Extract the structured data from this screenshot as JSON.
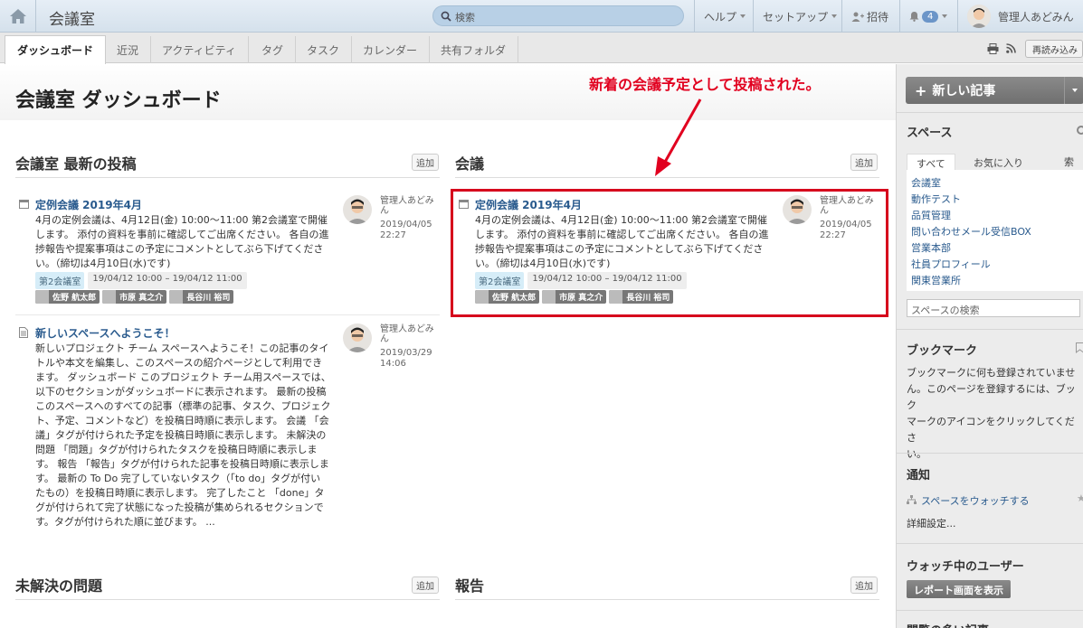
{
  "topbar": {
    "title": "会議室",
    "search_placeholder": "検索",
    "help": "ヘルプ",
    "setup": "セットアップ",
    "invite": "招待",
    "notifications_count": "4",
    "user_name": "管理人あどみん"
  },
  "tabs": [
    "ダッシュボード",
    "近況",
    "アクティビティ",
    "タグ",
    "タスク",
    "カレンダー",
    "共有フォルダ"
  ],
  "reload_label": "再読み込み",
  "page": {
    "title": "会議室 ダッシュボード",
    "annotation": "新着の会議予定として投稿された。"
  },
  "sections": {
    "latest": "会議室 最新の投稿",
    "meetings": "会議",
    "issues": "未解決の問題",
    "reports": "報告",
    "add": "追加"
  },
  "posts": {
    "meeting_left": {
      "title": "定例会議 2019年4月",
      "body": [
        "4月の定例会議は、4月12日(金) 10:00〜11:00 第2会議室で開催",
        "します。 添付の資料を事前に確認してご出席ください。 各自の進",
        "捗報告や提案事項はこの予定にコメントとしてぶら下げてくださ",
        "い。（締切は4月10日(水)です)"
      ],
      "author": [
        "管理人あどみ",
        "ん"
      ],
      "date": "2019/04/05",
      "time": "22:27",
      "room": "第2会議室",
      "range": "19/04/12 10:00 – 19/04/12 11:00",
      "attendees": [
        "佐野 航太郎",
        "市原 真之介",
        "長谷川 裕司"
      ]
    },
    "welcome": {
      "title": "新しいスペースへようこそ！",
      "body": [
        "新しいプロジェクト チーム スペースへようこそ！この記事のタイ",
        "トルや本文を編集し、このスペースの紹介ページとして利用でき",
        "ます。 ダッシュボード このプロジェクト チーム用スペースでは、",
        "以下のセクションがダッシュボードに表示されます。 最新の投稿",
        "このスペースへのすべての記事（標準の記事、タスク、プロジェク",
        "ト、予定、コメントなど）を投稿日時順に表示します。 会議 「会",
        "議」タグが付けられた予定を投稿日時順に表示します。 未解決の",
        "問題 「問題」タグが付けられたタスクを投稿日時順に表示しま",
        "す。 報告 「報告」タグが付けられた記事を投稿日時順に表示しま",
        "す。 最新の To Do 完了していないタスク（「to do」タグが付い",
        "たもの）を投稿日時順に表示します。 完了したこと 「done」タ",
        "グが付けられて完了状態になった投稿が集められるセクションで",
        "す。タグが付けられた順に並びます。 ..."
      ],
      "author": [
        "管理人あどみ",
        "ん"
      ],
      "date": "2019/03/29",
      "time": "14:06"
    },
    "meeting_right": {
      "title": "定例会議 2019年4月",
      "body": [
        "4月の定例会議は、4月12日(金) 10:00〜11:00 第2会議室で開催",
        "します。 添付の資料を事前に確認してご出席ください。 各自の進",
        "捗報告や提案事項はこの予定にコメントとしてぶら下げてくださ",
        "い。（締切は4月10日(水)です)"
      ],
      "author": [
        "管理人あどみ",
        "ん"
      ],
      "date": "2019/04/05",
      "time": "22:27",
      "room": "第2会議室",
      "range": "19/04/12 10:00 – 19/04/12 11:00",
      "attendees": [
        "佐野 航太郎",
        "市原 真之介",
        "長谷川 裕司"
      ]
    }
  },
  "sidebar": {
    "new_article": "新しい記事",
    "spaces_title": "スペース",
    "tab_all": "すべて",
    "tab_fav": "お気に入り",
    "tab_index": "索引",
    "spaces": [
      "会議室",
      "動作テスト",
      "品質管理",
      "問い合わせメール受信BOX",
      "営業本部",
      "社員プロフィール",
      "関東営業所"
    ],
    "space_search": "スペースの検索",
    "bookmark_title": "ブックマーク",
    "bookmark_text": [
      "ブックマークに何も登録されていませ",
      "ん。このページを登録するには、ブック",
      "マークのアイコンをクリックしてくださ",
      "い。"
    ],
    "notify_title": "通知",
    "watch_space": "スペースをウォッチする",
    "details": "詳細設定...",
    "watchers_title": "ウォッチ中のユーザー",
    "report_btn": "レポート画面を表示",
    "popular_title": "閲覧の多い記事"
  },
  "colors": {
    "accent_red": "#d6001c",
    "link": "#2a5b8e",
    "annotation": "#e1001f"
  }
}
